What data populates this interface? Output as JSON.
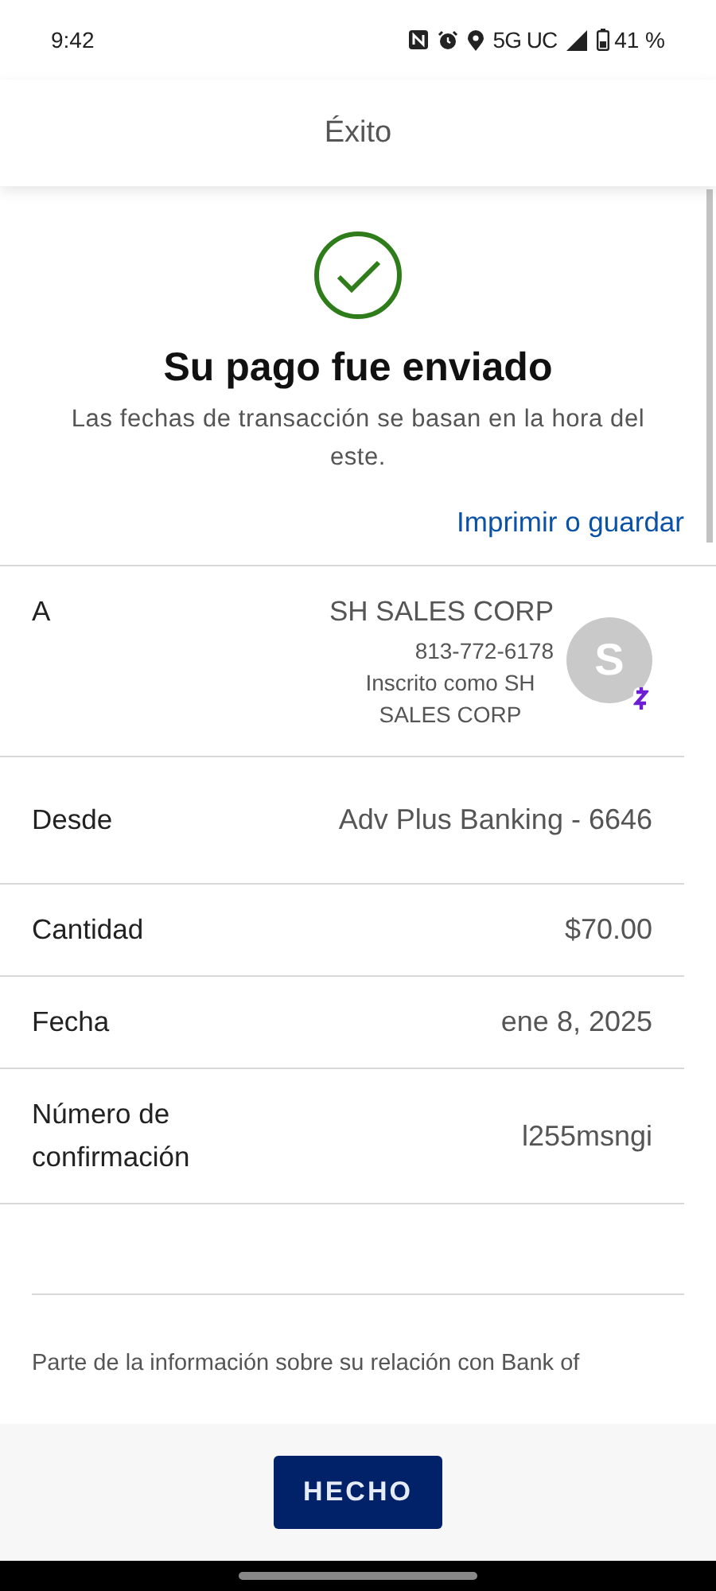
{
  "status_bar": {
    "time": "9:42",
    "network": "5G UC",
    "battery": "41 %"
  },
  "header": {
    "title": "Éxito"
  },
  "result": {
    "title": "Su pago fue enviado",
    "note": "Las fechas de transacción se basan en la hora del este.",
    "link": "Imprimir o guardar"
  },
  "recipient": {
    "label": "A",
    "name": "SH SALES CORP",
    "phone": "813-772-6178",
    "enrolled": "Inscrito como SH SALES CORP",
    "avatar": "S"
  },
  "details": [
    {
      "label": "Desde",
      "value": "Adv Plus Banking - 6646"
    },
    {
      "label": "Cantidad",
      "value": "$70.00"
    },
    {
      "label": "Fecha",
      "value": "ene 8, 2025"
    },
    {
      "label": "Número de confirmación",
      "value": "l255msngi"
    }
  ],
  "disclaimer": "Parte de la información sobre su relación con Bank of",
  "footer": {
    "button": "HECHO"
  }
}
